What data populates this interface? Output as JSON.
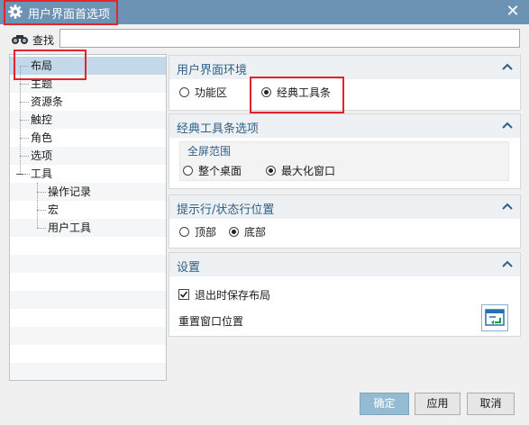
{
  "window": {
    "title": "用户界面首选项",
    "close_glyph": "✕"
  },
  "search": {
    "label": "查找",
    "value": "",
    "placeholder": ""
  },
  "tree": {
    "items": [
      {
        "label": "布局",
        "selected": true
      },
      {
        "label": "主题"
      },
      {
        "label": "资源条"
      },
      {
        "label": "触控"
      },
      {
        "label": "角色"
      },
      {
        "label": "选项"
      },
      {
        "label": "工具",
        "expanded": true
      },
      {
        "label": "操作记录"
      },
      {
        "label": "宏"
      },
      {
        "label": "用户工具"
      }
    ]
  },
  "sections": {
    "ui_env": {
      "title": "用户界面环境",
      "options": [
        {
          "label": "功能区",
          "checked": false
        },
        {
          "label": "经典工具条",
          "checked": true
        }
      ]
    },
    "classic_toolbar": {
      "title": "经典工具条选项",
      "group_title": "全屏范围",
      "options": [
        {
          "label": "整个桌面",
          "checked": false
        },
        {
          "label": "最大化窗口",
          "checked": true
        }
      ]
    },
    "prompt_status": {
      "title": "提示行/状态行位置",
      "options": [
        {
          "label": "顶部",
          "checked": false
        },
        {
          "label": "底部",
          "checked": true
        }
      ]
    },
    "settings": {
      "title": "设置",
      "save_layout_label": "退出时保存布局",
      "save_layout_checked": true,
      "reset_label": "重置窗口位置"
    }
  },
  "buttons": {
    "ok": "确定",
    "apply": "应用",
    "cancel": "取消"
  },
  "icons": {
    "title": "gear-icon",
    "search": "binoculars-icon",
    "collapse": "chevron-up-icon",
    "reset": "reset-window-icon"
  },
  "colors": {
    "titlebar": "#6c93b3",
    "section_title": "#2e5f86",
    "tree_selected": "#c3d9ea",
    "primary_button": "#94bbd2",
    "highlight": "#e0262b"
  }
}
